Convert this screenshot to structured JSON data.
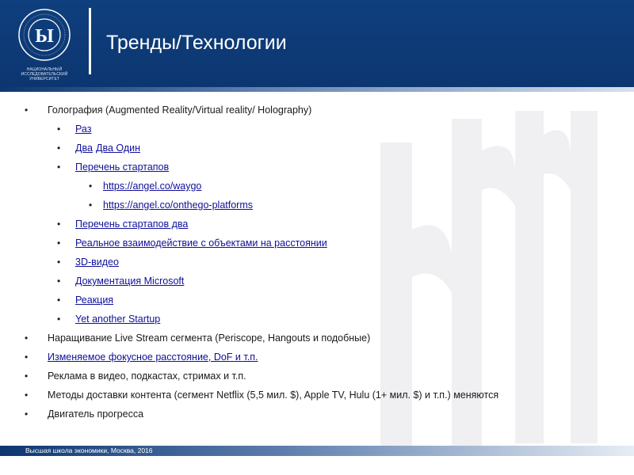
{
  "header": {
    "title": "Тренды/Технологии",
    "logo_caption": "НАЦИОНАЛЬНЫЙ ИССЛЕДОВАТЕЛЬСКИЙ УНИВЕРСИТЕТ",
    "logo_ring_text": "ВЫСШАЯ ШКОЛА ЭКОНОМИКИ",
    "logo_icon": "hse-logo-icon"
  },
  "items": [
    {
      "level": 1,
      "text": "Голография (Augmented Reality/Virtual reality/ Holography)",
      "link": false
    },
    {
      "level": 2,
      "text": "Раз",
      "link": true
    },
    {
      "level": 2,
      "text": "Два",
      "link": true,
      "extra": "Два Один"
    },
    {
      "level": 2,
      "text": "Перечень стартапов",
      "link": true
    },
    {
      "level": 3,
      "text": "https://angel.co/waygo",
      "link": true
    },
    {
      "level": 3,
      "text": "https://angel.co/onthego-platforms",
      "link": true
    },
    {
      "level": 2,
      "text": "Перечень стартапов два",
      "link": true
    },
    {
      "level": 2,
      "text": "Реальное взаимодействие с объектами на расстоянии",
      "link": true
    },
    {
      "level": 2,
      "text": "3D-видео",
      "link": true
    },
    {
      "level": 2,
      "text": "Документация Microsoft",
      "link": true
    },
    {
      "level": 2,
      "text": "Реакция",
      "link": true
    },
    {
      "level": 2,
      "text": "Yet another Startup",
      "link": true
    },
    {
      "level": 1,
      "text": "Наращивание Live Stream сегмента (Periscope, Hangouts и подобные)",
      "link": false
    },
    {
      "level": 1,
      "text": "Изменяемое фокусное расстояние, DoF и т.п.",
      "link": true
    },
    {
      "level": 1,
      "text": "Реклама в видео, подкастах, стримах и т.п.",
      "link": false
    },
    {
      "level": 1,
      "text": "Методы доставки контента (сегмент Netflix (5,5 мил. $), Apple TV, Hulu (1+ мил. $) и т.п.) меняются",
      "link": false
    },
    {
      "level": 1,
      "text": "Двигатель прогресса",
      "link": false
    }
  ],
  "bullet_symbol": "•",
  "footer": {
    "text": "Высшая школа экономики, Москва, 2016"
  },
  "colors": {
    "header": "#0f3f7e",
    "link": "#10109a",
    "text": "#1a1a1a"
  }
}
